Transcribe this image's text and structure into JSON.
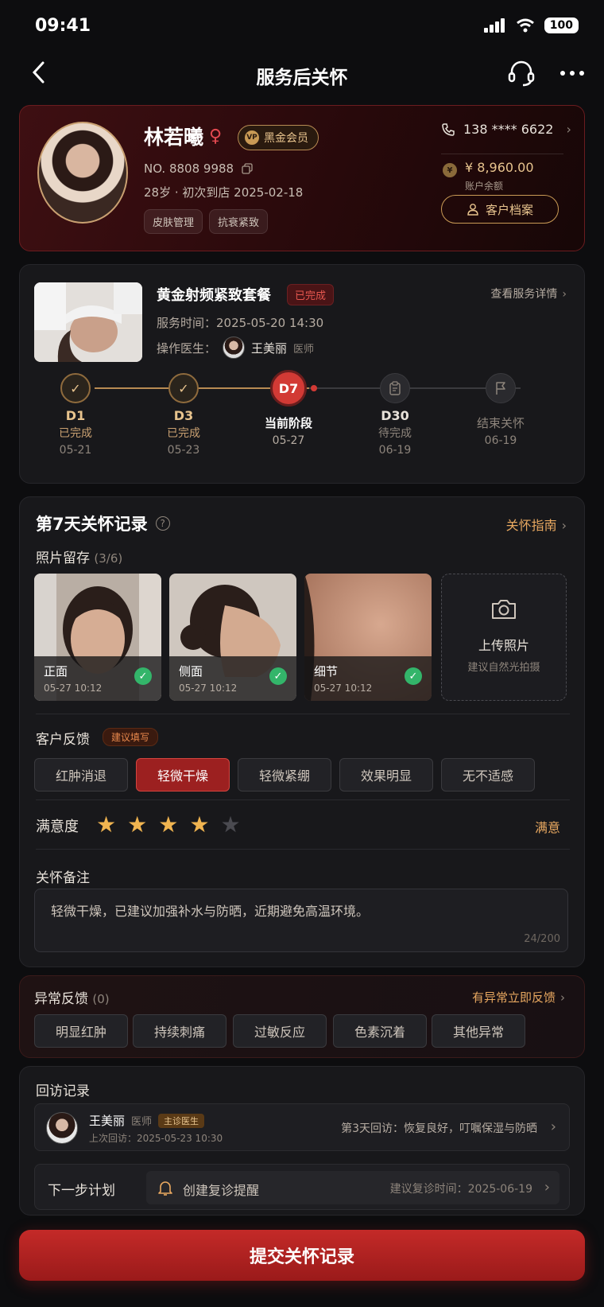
{
  "status": {
    "time": "09:41",
    "battery": "100"
  },
  "nav": {
    "title": "服务后关怀"
  },
  "profile": {
    "name": "林若曦",
    "vip": "黑金会员",
    "vip_icon": "VP",
    "number": "NO. 8808 9988",
    "age_visit": "28岁 · 初次到店 2025-02-18",
    "tags": [
      "皮肤管理",
      "抗衰紧致"
    ],
    "phone": "138 **** 6622",
    "balance": "¥ 8,960.00",
    "balance_label": "账户余额",
    "archive_btn": "客户档案"
  },
  "service": {
    "name": "黄金射频紧致套餐",
    "status": "已完成",
    "detail_link": "查看服务详情",
    "time": "服务时间：2025-05-20 14:30",
    "doctor_label": "操作医生：",
    "doctor_name": "王美丽",
    "doctor_role": "医师"
  },
  "timeline": [
    {
      "day": "D1",
      "status": "已完成",
      "date": "05-21"
    },
    {
      "day": "D3",
      "status": "已完成",
      "date": "05-23"
    },
    {
      "day": "D7",
      "status": "当前阶段",
      "date": "05-27"
    },
    {
      "day": "D30",
      "status": "待完成",
      "date": "06-19"
    },
    {
      "day": "",
      "status": "结束关怀",
      "date": "06-19"
    }
  ],
  "record": {
    "title": "第7天关怀记录",
    "guide": "关怀指南",
    "photo_label": "照片留存",
    "photo_count": "(3/6)",
    "photos": [
      {
        "name": "正面",
        "time": "05-27 10:12"
      },
      {
        "name": "侧面",
        "time": "05-27 10:12"
      },
      {
        "name": "细节",
        "time": "05-27 10:12"
      }
    ],
    "upload_label": "上传照片",
    "upload_hint": "建议自然光拍摄",
    "feedback_label": "客户反馈",
    "feedback_hint": "建议填写",
    "feedback_options": [
      "红肿消退",
      "轻微干燥",
      "轻微紧绷",
      "效果明显",
      "无不适感"
    ],
    "feedback_selected": 1,
    "satisfaction_label": "满意度",
    "rating": 4,
    "rating_max": 5,
    "satisfaction_value": "满意",
    "note_label": "关怀备注",
    "note_text": "轻微干燥，已建议加强补水与防晒，近期避免高温环境。",
    "note_count": "24/200"
  },
  "abnormal": {
    "title": "异常反馈",
    "count": "(0)",
    "link": "有异常立即反馈",
    "options": [
      "明显红肿",
      "持续刺痛",
      "过敏反应",
      "色素沉着",
      "其他异常"
    ]
  },
  "revisit": {
    "title": "回访记录",
    "name": "王美丽",
    "role": "医师",
    "badge": "主诊医生",
    "time": "上次回访：2025-05-23 10:30",
    "note": "第3天回访：恢复良好，叮嘱保湿与防晒",
    "plan_label": "下一步计划",
    "plan_action": "创建复诊提醒",
    "plan_suggest": "建议复诊时间：2025-06-19"
  },
  "submit": "提交关怀记录",
  "colors": {
    "accent": "#d23a35",
    "gold": "#e8c48e",
    "bg": "#0d0d0f"
  }
}
